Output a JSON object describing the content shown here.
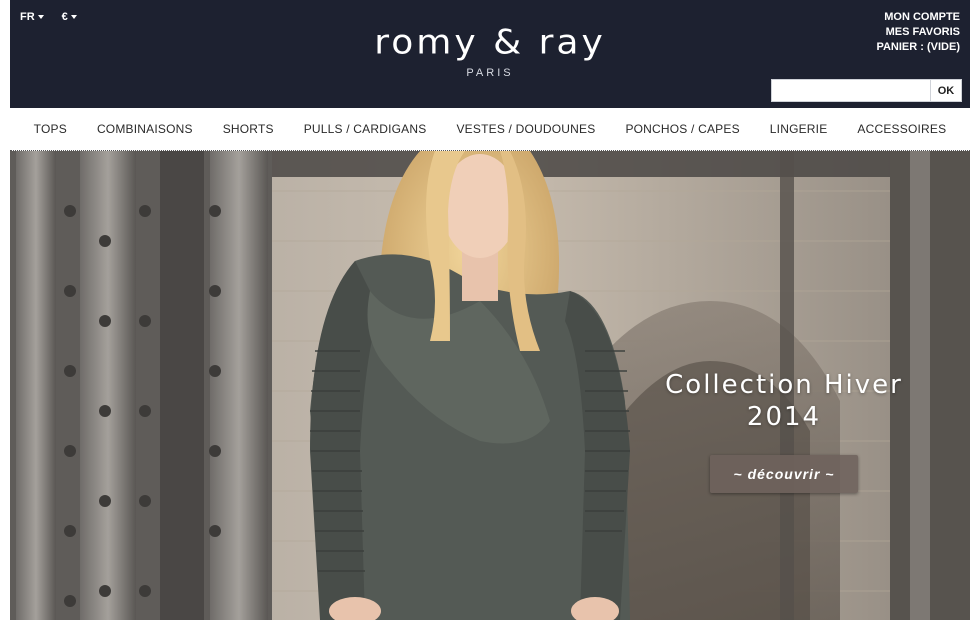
{
  "header": {
    "language": "FR",
    "currency": "€",
    "brand": "romy & ray",
    "brand_city": "PARIS",
    "account_links": [
      "MON COMPTE",
      "MES FAVORIS",
      "PANIER : (VIDE)"
    ],
    "search": {
      "placeholder": "",
      "button_label": "OK"
    },
    "background_color": "#1d2130"
  },
  "nav": {
    "items": [
      "TOPS",
      "COMBINAISONS",
      "SHORTS",
      "PULLS / CARDIGANS",
      "VESTES / DOUDOUNES",
      "PONCHOS / CAPES",
      "LINGERIE",
      "ACCESSOIRES"
    ]
  },
  "hero": {
    "title_line1": "Collection Hiver",
    "title_line2": "2014",
    "cta_label": "~ découvrir ~"
  }
}
